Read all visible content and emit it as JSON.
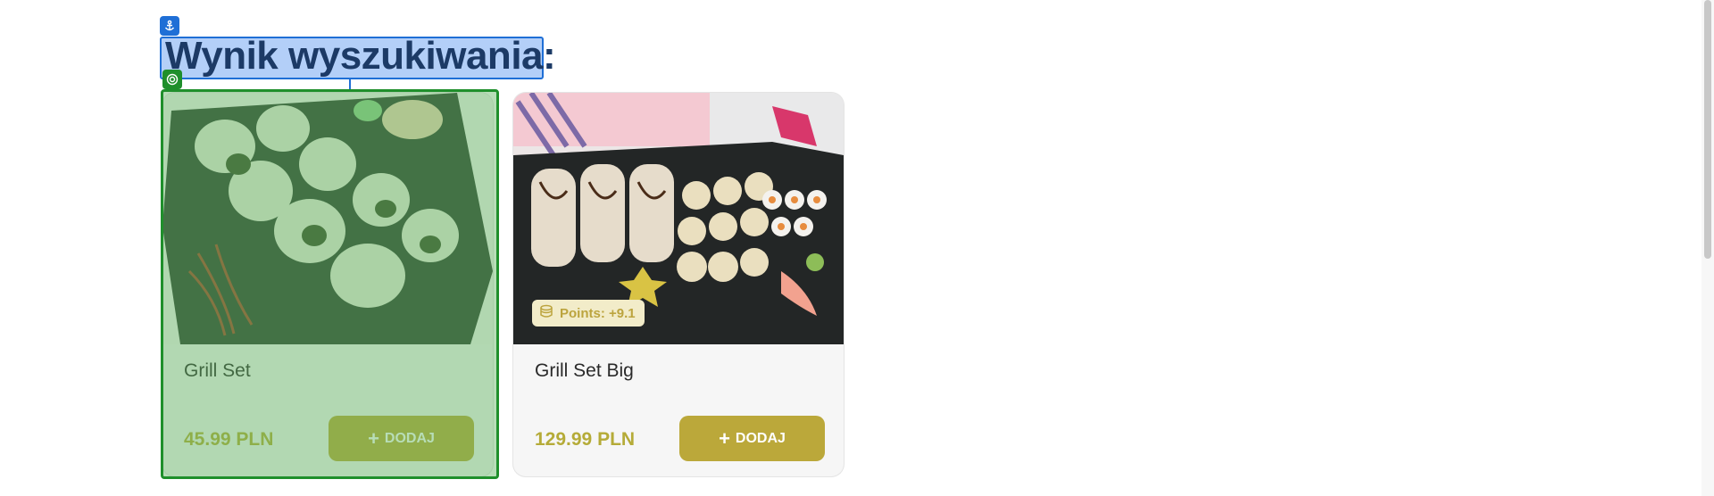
{
  "page": {
    "heading": "Wynik wyszukiwania:"
  },
  "products": [
    {
      "name": "Grill Set",
      "price": "45.99 PLN",
      "button_label": "DODAJ",
      "points": null
    },
    {
      "name": "Grill Set Big",
      "price": "129.99 PLN",
      "button_label": "DODAJ",
      "points": "Points: +9.1"
    }
  ],
  "colors": {
    "accent": "#bba83a",
    "price": "#b5ab38",
    "heading": "#1c3a66",
    "selection_blue": "#1f6fd6",
    "selection_green": "#1f8f2b"
  },
  "icons": {
    "anchor": "anchor-icon",
    "target": "target-icon",
    "plus": "plus-icon",
    "points": "coins-icon"
  }
}
